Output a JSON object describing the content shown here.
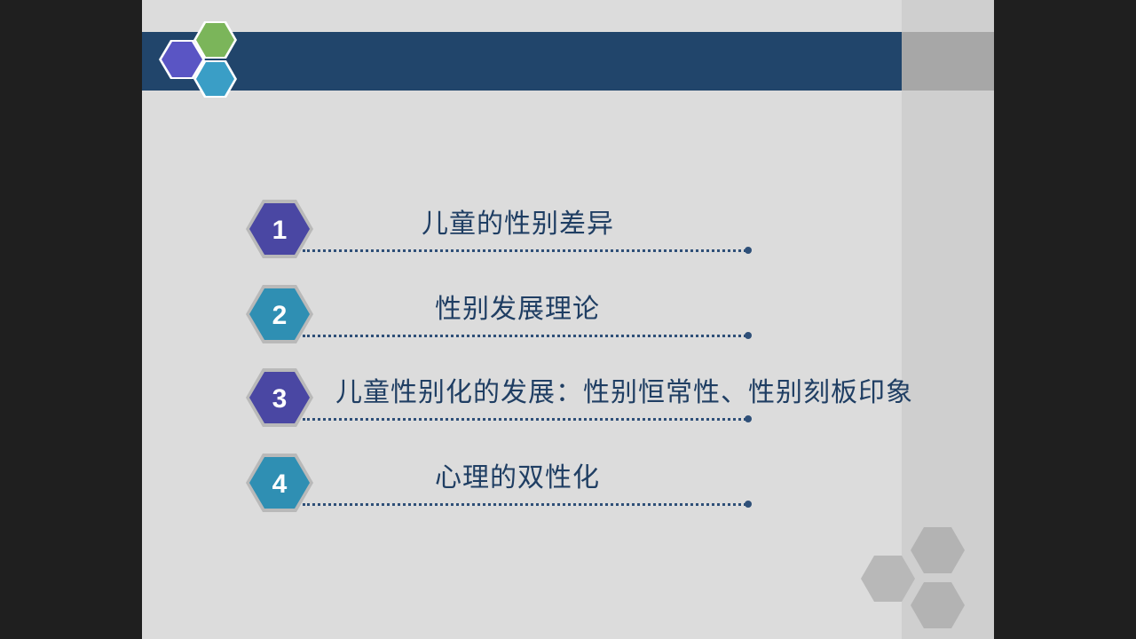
{
  "slide": {
    "items": [
      {
        "number": "1",
        "label": "儿童的性别差异",
        "color": "#4a47a3"
      },
      {
        "number": "2",
        "label": "性别发展理论",
        "color": "#2f8fb3"
      },
      {
        "number": "3",
        "label": "儿童性别化的发展：性别恒常性、性别刻板印象",
        "color": "#4a47a3"
      },
      {
        "number": "4",
        "label": "心理的双性化",
        "color": "#2f8fb3"
      }
    ]
  },
  "colors": {
    "header": "#21456b",
    "hex_purple": "#5a55c4",
    "hex_green": "#7bb55a",
    "hex_blue": "#3a9ec6",
    "text": "#1f3e63"
  },
  "icons": [
    "hexagon-cluster-logo-icon",
    "hexagon-cluster-decor-icon"
  ]
}
